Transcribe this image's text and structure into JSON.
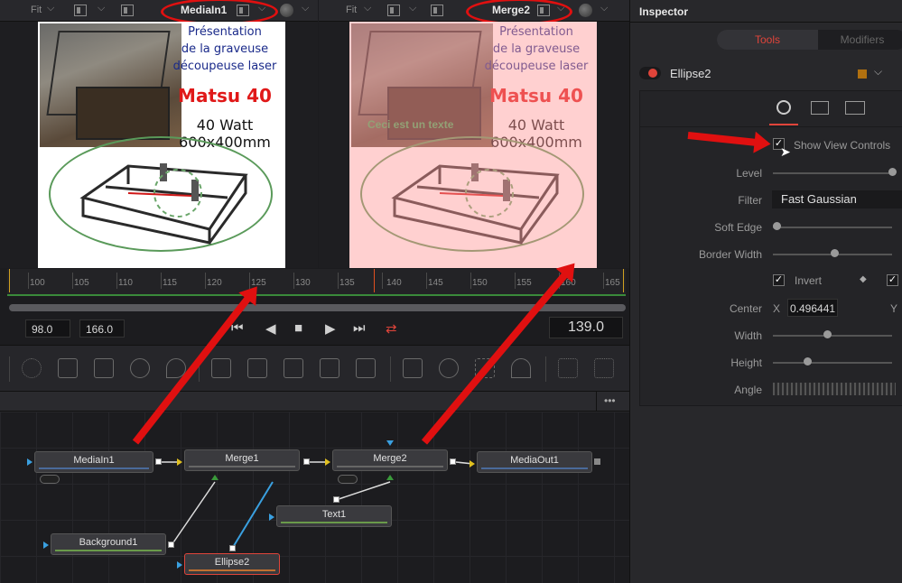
{
  "viewer_left": {
    "fit_label": "Fit",
    "name": "MediaIn1",
    "content": {
      "title_line1": "Présentation",
      "title_line2": "de la graveuse",
      "title_line3": "découpeuse laser",
      "product": "Matsu 40",
      "power": "40 Watt",
      "size": "600x400mm"
    }
  },
  "viewer_right": {
    "fit_label": "Fit",
    "name": "Merge2",
    "content": {
      "title_line1": "Présentation",
      "title_line2": "de la graveuse",
      "title_line3": "découpeuse laser",
      "product": "Matsu 40",
      "power": "40 Watt",
      "size": "600x400mm",
      "overlay_text": "Ceci est un texte"
    }
  },
  "timeline": {
    "ticks": [
      "100",
      "105",
      "110",
      "115",
      "120",
      "125",
      "130",
      "135",
      "140",
      "145",
      "150",
      "155",
      "160",
      "165"
    ],
    "start": "98.0",
    "end": "166.0",
    "current": "139.0"
  },
  "node_editor": {
    "more_label": "•••",
    "nodes": {
      "mediain1": "MediaIn1",
      "merge1": "Merge1",
      "merge2": "Merge2",
      "mediaout1": "MediaOut1",
      "text1": "Text1",
      "background1": "Background1",
      "ellipse2": "Ellipse2"
    }
  },
  "inspector": {
    "title": "Inspector",
    "tabs": {
      "tools": "Tools",
      "modifiers": "Modifiers"
    },
    "tool_name": "Ellipse2",
    "show_view_controls": "Show View Controls",
    "level_label": "Level",
    "filter_label": "Filter",
    "filter_value": "Fast Gaussian",
    "soft_edge_label": "Soft Edge",
    "border_width_label": "Border Width",
    "invert_label": "Invert",
    "center_label": "Center",
    "center_x_label": "X",
    "center_x_value": "0.496441",
    "center_y_label": "Y",
    "width_label": "Width",
    "height_label": "Height",
    "angle_label": "Angle"
  },
  "colors": {
    "accent_red": "#e01010",
    "tab_active": "#e0443a",
    "line_green": "#3a9a3a",
    "link_blue": "#3aa0e0"
  }
}
